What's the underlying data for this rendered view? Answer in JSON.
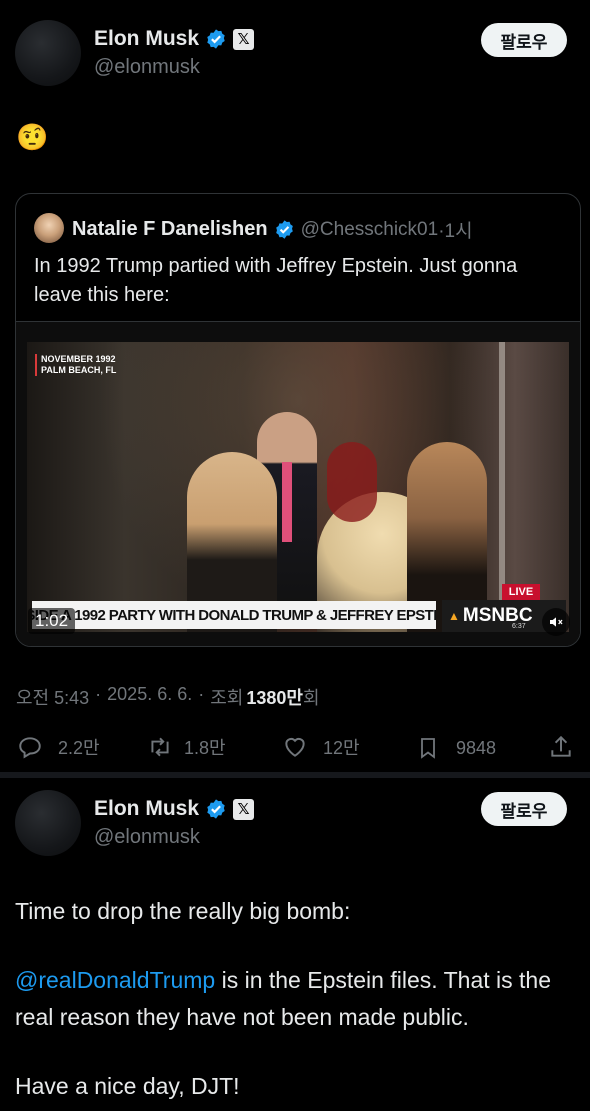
{
  "post1": {
    "author_name": "Elon Musk",
    "author_handle": "@elonmusk",
    "follow_label": "팔로우",
    "text": "🤨",
    "quote": {
      "author_name": "Natalie F Danelishen",
      "author_handle": "@Chesschick01",
      "time": "·1시",
      "text": "In 1992 Trump partied with Jeffrey Epstein. Just gonna leave this here:",
      "video": {
        "caption_date": "NOVEMBER 1992",
        "caption_place": "PALM BEACH, FL",
        "lower_third": "INSIDE A 1992 PARTY WITH DONALD TRUMP & JEFFREY EPSTEIN",
        "network": "MSNBC",
        "live_label": "LIVE",
        "clock": "6:37",
        "duration": "1:02"
      }
    },
    "meta": {
      "time": "오전 5:43",
      "date": "2025. 6. 6.",
      "views_prefix": "조회",
      "views_count": "1380만",
      "views_suffix": "회"
    },
    "actions": {
      "replies": "2.2만",
      "reposts": "1.8만",
      "likes": "12만",
      "bookmarks": "9848"
    }
  },
  "post2": {
    "author_name": "Elon Musk",
    "author_handle": "@elonmusk",
    "follow_label": "팔로우",
    "line1": "Time to drop the really big bomb:",
    "mention": "@realDonaldTrump",
    "line2_rest": " is in the Epstein files. That is the real reason they have not been made public.",
    "line3": "Have a nice day, DJT!"
  },
  "colors": {
    "background": "#000000",
    "text": "#e7e9ea",
    "muted": "#71767b",
    "accent": "#1d9bf0",
    "follow_bg": "#eff3f4"
  }
}
